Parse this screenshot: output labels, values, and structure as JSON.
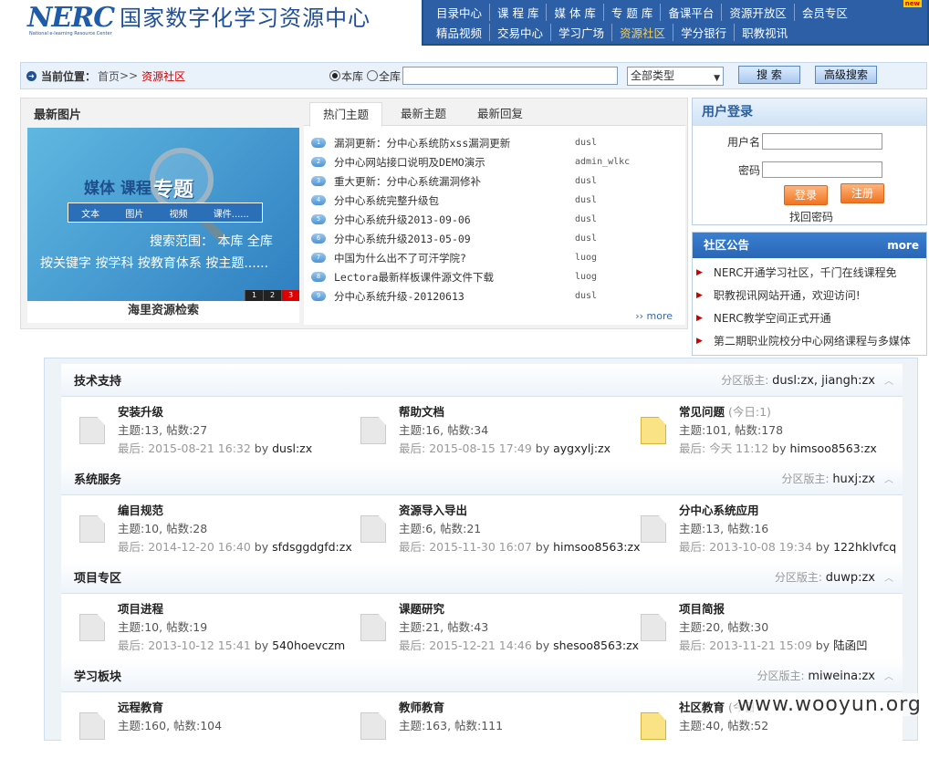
{
  "header": {
    "logo_text": "NERC",
    "logo_subtitle": "National e-learning Resource Center",
    "site_title": "国家数字化学习资源中心",
    "nav_row1": [
      "目录中心",
      "课 程 库",
      "媒 体 库",
      "专 题 库",
      "备课平台",
      "资源开放区",
      "会员专区"
    ],
    "nav_row2": [
      "精品视频",
      "交易中心",
      "学习广场",
      "资源社区",
      "学分银行",
      "职教视讯"
    ],
    "active_nav": "资源社区",
    "new_badge": "new"
  },
  "location": {
    "label": "当前位置：",
    "home": "首页",
    "sep": ">>",
    "current": "资源社区"
  },
  "search": {
    "scope_this": "本库",
    "scope_all": "全库",
    "type_selected": "全部类型",
    "search_button": "搜 索",
    "advanced_button": "高级搜索"
  },
  "latest_images": {
    "title": "最新图片",
    "slide_tag1": "媒体 课程",
    "slide_tag2": "专题",
    "slide_menu": [
      "文本",
      "图片",
      "视频",
      "课件......"
    ],
    "slide_line1": "搜索范围：  本库    全库",
    "slide_line2": "按关键字  按学科  按教育体系  按主题......",
    "pager": [
      "1",
      "2",
      "3"
    ],
    "caption": "海里资源检索"
  },
  "topics": {
    "tabs": [
      "热门主题",
      "最新主题",
      "最新回复"
    ],
    "items": [
      {
        "num": "1",
        "title": "漏洞更新：分中心系统防xss漏洞更新",
        "author": "dusl"
      },
      {
        "num": "2",
        "title": "分中心网站接口说明及DEMO演示",
        "author": "admin_wlkc"
      },
      {
        "num": "3",
        "title": "重大更新：分中心系统漏洞修补",
        "author": "dusl"
      },
      {
        "num": "4",
        "title": "分中心系统完整升级包",
        "author": "dusl"
      },
      {
        "num": "5",
        "title": "分中心系统升级2013-09-06",
        "author": "dusl"
      },
      {
        "num": "6",
        "title": "分中心系统升级2013-05-09",
        "author": "dusl"
      },
      {
        "num": "7",
        "title": "中国为什么出不了可汗学院?",
        "author": "luog"
      },
      {
        "num": "8",
        "title": "Lectora最新样板课件源文件下载",
        "author": "luog"
      },
      {
        "num": "9",
        "title": "分中心系统升级-20120613",
        "author": "dusl"
      }
    ],
    "more": "›› more"
  },
  "login": {
    "title": "用户登录",
    "username_label": "用户名",
    "password_label": "密码",
    "login_button": "登录",
    "register_button": "注册",
    "forgot": "找回密码"
  },
  "notice": {
    "title": "社区公告",
    "more": "more",
    "items": [
      "NERC开通学习社区，千门在线课程免",
      "职教视讯网站开通，欢迎访问!",
      "NERC教学空间正式开通",
      "第二期职业院校分中心网络课程与多媒体"
    ]
  },
  "forum": {
    "mod_label": "分区版主:",
    "sections": [
      {
        "title": "技术支持",
        "mods": "dusl:zx, jiangh:zx",
        "forums": [
          {
            "name": "安装升级",
            "today": "",
            "stats": "主题:13, 帖数:27",
            "last_label": "最后:",
            "last_time": "2015-08-21 16:32",
            "by": "by",
            "user": "dusl:zx",
            "new": false
          },
          {
            "name": "帮助文档",
            "today": "",
            "stats": "主题:16, 帖数:34",
            "last_label": "最后:",
            "last_time": "2015-08-15 17:49",
            "by": "by",
            "user": "aygxylj:zx",
            "new": false
          },
          {
            "name": "常见问题",
            "today": "(今日:1)",
            "stats": "主题:101, 帖数:178",
            "last_label": "最后:",
            "last_time": "今天 11:12",
            "by": "by",
            "user": "himsoo8563:zx",
            "new": true
          }
        ]
      },
      {
        "title": "系统服务",
        "mods": "huxj:zx",
        "forums": [
          {
            "name": "编目规范",
            "today": "",
            "stats": "主题:10, 帖数:28",
            "last_label": "最后:",
            "last_time": "2014-12-20 16:40",
            "by": "by",
            "user": "sfdsggdgfd:zx",
            "new": false
          },
          {
            "name": "资源导入导出",
            "today": "",
            "stats": "主题:6, 帖数:21",
            "last_label": "最后:",
            "last_time": "2015-11-30 16:07",
            "by": "by",
            "user": "himsoo8563:zx",
            "new": false
          },
          {
            "name": "分中心系统应用",
            "today": "",
            "stats": "主题:13, 帖数:16",
            "last_label": "最后:",
            "last_time": "2013-10-08 19:34",
            "by": "by",
            "user": "122hklvfcq",
            "new": false
          }
        ]
      },
      {
        "title": "项目专区",
        "mods": "duwp:zx",
        "forums": [
          {
            "name": "项目进程",
            "today": "",
            "stats": "主题:10, 帖数:19",
            "last_label": "最后:",
            "last_time": "2013-10-12 15:41",
            "by": "by",
            "user": "540hoevczm",
            "new": false
          },
          {
            "name": "课题研究",
            "today": "",
            "stats": "主题:21, 帖数:43",
            "last_label": "最后:",
            "last_time": "2015-12-21 14:46",
            "by": "by",
            "user": "shesoo8563:zx",
            "new": false
          },
          {
            "name": "项目简报",
            "today": "",
            "stats": "主题:20, 帖数:30",
            "last_label": "最后:",
            "last_time": "2013-11-21 15:09",
            "by": "by",
            "user": "陆函凹",
            "new": false
          }
        ]
      },
      {
        "title": "学习板块",
        "mods": "miweina:zx",
        "forums": [
          {
            "name": "远程教育",
            "today": "",
            "stats": "主题:160, 帖数:104",
            "last_label": "",
            "last_time": "",
            "by": "",
            "user": "",
            "new": false
          },
          {
            "name": "教师教育",
            "today": "",
            "stats": "主题:163, 帖数:111",
            "last_label": "",
            "last_time": "",
            "by": "",
            "user": "",
            "new": false
          },
          {
            "name": "社区教育",
            "today": "(今日",
            "stats": "主题:40, 帖数:52",
            "last_label": "",
            "last_time": "",
            "by": "",
            "user": "",
            "new": true
          }
        ]
      }
    ]
  },
  "watermark": "www.wooyun.org"
}
